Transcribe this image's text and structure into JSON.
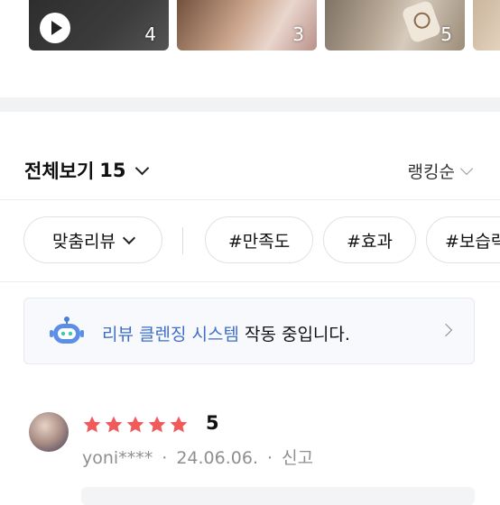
{
  "media": {
    "thumbs": [
      {
        "count": "4",
        "has_play": true
      },
      {
        "count": "3",
        "has_play": false
      },
      {
        "count": "5",
        "has_play": false
      }
    ]
  },
  "filter": {
    "all_label": "전체보기",
    "all_count": "15",
    "sort_label": "랭킹순"
  },
  "chips": {
    "custom": "맞춤리뷰",
    "tags": [
      "#만족도",
      "#효과",
      "#보습력"
    ]
  },
  "banner": {
    "highlight": "리뷰 클렌징 시스템",
    "rest": " 작동 중입니다."
  },
  "review": {
    "rating": "5",
    "stars": 5,
    "user": "yoni****",
    "date": "24.06.06.",
    "report": "신고",
    "dot": "·"
  },
  "colors": {
    "star": "#f05a5a",
    "highlight": "#3d6ec8",
    "meta": "#8f8f8f"
  }
}
